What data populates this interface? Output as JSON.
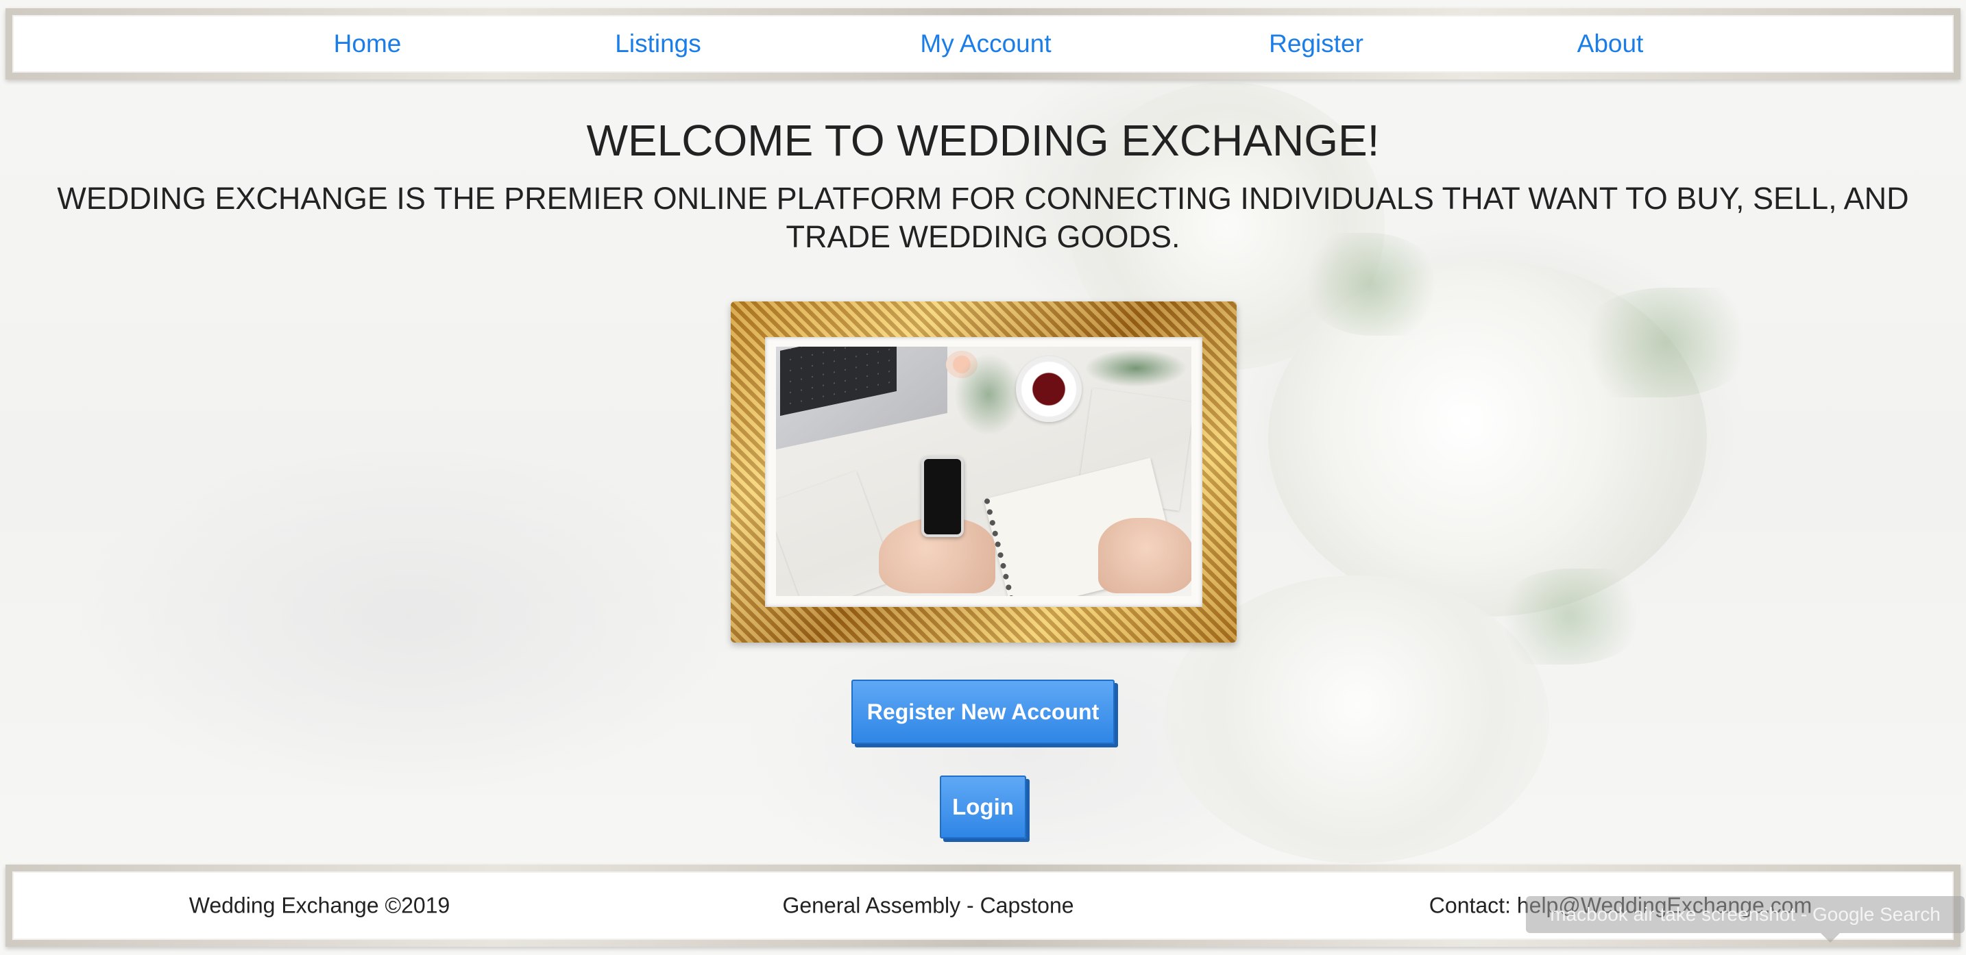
{
  "nav": {
    "items": [
      {
        "label": "Home"
      },
      {
        "label": "Listings"
      },
      {
        "label": "My Account"
      },
      {
        "label": "Register"
      },
      {
        "label": "About"
      }
    ]
  },
  "hero": {
    "title": "WELCOME TO WEDDING EXCHANGE!",
    "subtitle": "WEDDING EXCHANGE IS THE PREMIER ONLINE PLATFORM FOR CONNECTING INDIVIDUALS THAT WANT TO BUY, SELL, AND TRADE WEDDING GOODS."
  },
  "buttons": {
    "register_label": "Register New Account",
    "login_label": "Login"
  },
  "footer": {
    "copyright": "Wedding Exchange ©2019",
    "credit": "General Assembly - Capstone",
    "contact": "Contact: help@WeddingExchange.com"
  },
  "tooltip": {
    "text": "macbook air take screenshot - Google Search"
  },
  "colors": {
    "link": "#1a7de8",
    "button": "#2f86e6",
    "button_shadow": "#1c5fae",
    "text": "#222222"
  }
}
